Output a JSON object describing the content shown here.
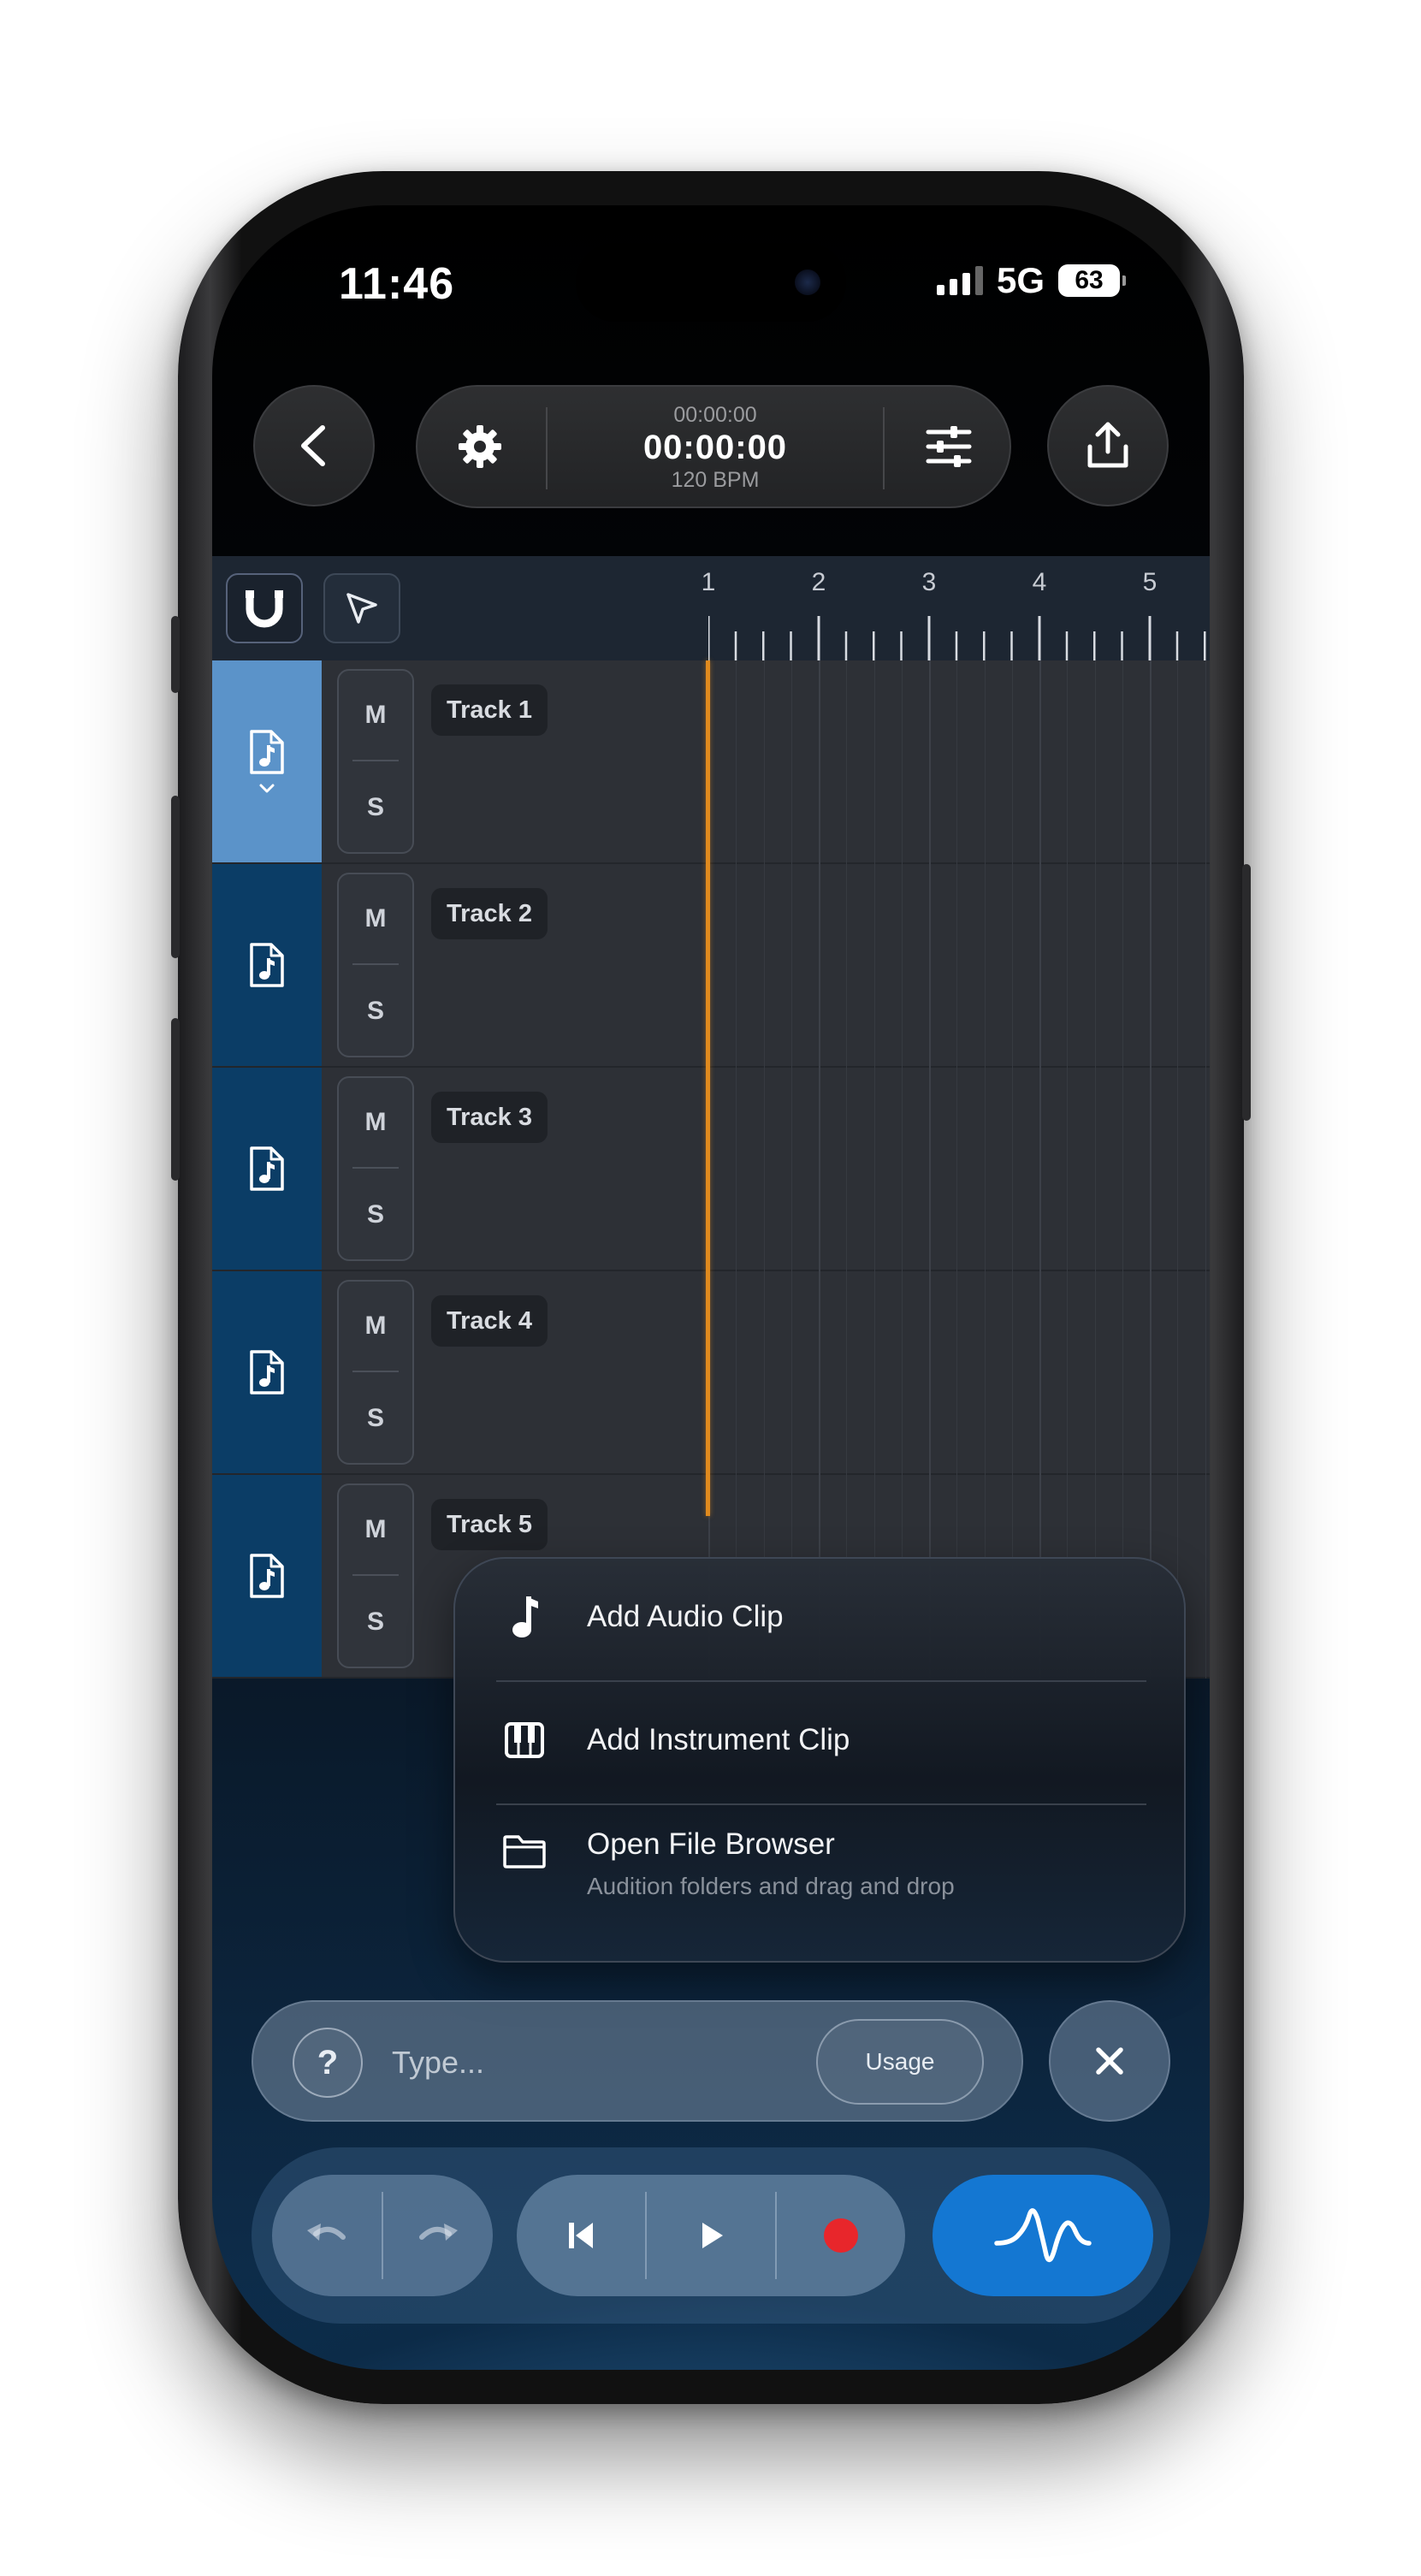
{
  "status_bar": {
    "time": "11:46",
    "network": "5G",
    "battery": "63"
  },
  "toolbar": {
    "time_top": "00:00:00",
    "time_main": "00:00:00",
    "bpm": "120 BPM"
  },
  "ruler": {
    "bars": [
      "1",
      "2",
      "3",
      "4",
      "5"
    ]
  },
  "tracks": [
    {
      "name": "Track 1",
      "mute": "M",
      "solo": "S",
      "selected": true
    },
    {
      "name": "Track 2",
      "mute": "M",
      "solo": "S",
      "selected": false
    },
    {
      "name": "Track 3",
      "mute": "M",
      "solo": "S",
      "selected": false
    },
    {
      "name": "Track 4",
      "mute": "M",
      "solo": "S",
      "selected": false
    },
    {
      "name": "Track 5",
      "mute": "M",
      "solo": "S",
      "selected": false
    }
  ],
  "menu": {
    "items": [
      {
        "label": "Add Audio Clip",
        "icon": "music-note-icon"
      },
      {
        "label": "Add Instrument Clip",
        "icon": "piano-icon"
      },
      {
        "label": "Open File Browser",
        "sub": "Audition folders and drag and drop",
        "icon": "folder-icon"
      }
    ]
  },
  "prompt": {
    "help": "?",
    "placeholder": "Type...",
    "usage": "Usage"
  },
  "colors": {
    "accent_blue": "#1477d2",
    "selected_track": "#5b93c9",
    "track_icon_bg": "#0b3d66",
    "playhead": "#e08a1e",
    "record": "#e8262b"
  }
}
